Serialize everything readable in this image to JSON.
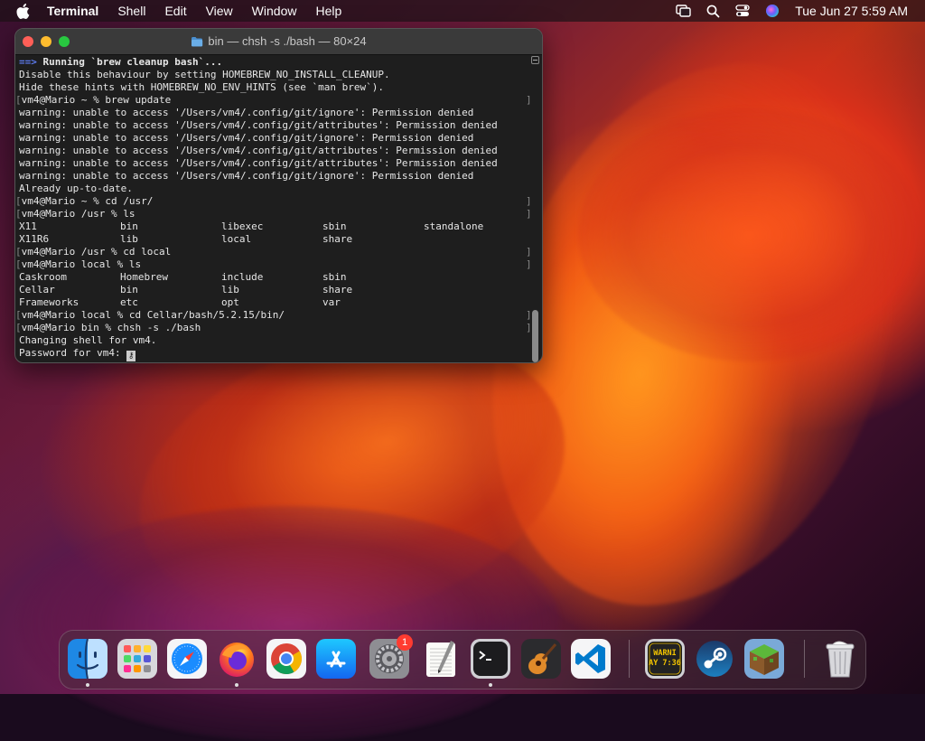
{
  "menubar": {
    "app_name": "Terminal",
    "items": [
      "Shell",
      "Edit",
      "View",
      "Window",
      "Help"
    ],
    "clock": "Tue Jun 27  5:59 AM",
    "status_icons": [
      "screen-mirroring-icon",
      "search-icon",
      "control-center-icon",
      "siri-icon"
    ]
  },
  "terminal": {
    "title": "bin — chsh -s ./bash — 80×24",
    "lines": [
      {
        "type": "arrow",
        "prefix": "==>",
        "text": " Running `brew cleanup bash`..."
      },
      {
        "type": "text",
        "text": "Disable this behaviour by setting HOMEBREW_NO_INSTALL_CLEANUP."
      },
      {
        "type": "text",
        "text": "Hide these hints with HOMEBREW_NO_ENV_HINTS (see `man brew`)."
      },
      {
        "type": "prompt",
        "text": "vm4@Mario ~ % brew update"
      },
      {
        "type": "text",
        "text": "warning: unable to access '/Users/vm4/.config/git/ignore': Permission denied"
      },
      {
        "type": "text",
        "text": "warning: unable to access '/Users/vm4/.config/git/attributes': Permission denied"
      },
      {
        "type": "text",
        "text": "warning: unable to access '/Users/vm4/.config/git/ignore': Permission denied"
      },
      {
        "type": "text",
        "text": "warning: unable to access '/Users/vm4/.config/git/attributes': Permission denied"
      },
      {
        "type": "text",
        "text": "warning: unable to access '/Users/vm4/.config/git/attributes': Permission denied"
      },
      {
        "type": "text",
        "text": "warning: unable to access '/Users/vm4/.config/git/ignore': Permission denied"
      },
      {
        "type": "text",
        "text": "Already up-to-date."
      },
      {
        "type": "prompt",
        "text": "vm4@Mario ~ % cd /usr/"
      },
      {
        "type": "prompt",
        "text": "vm4@Mario /usr % ls"
      },
      {
        "type": "cols",
        "cells": [
          "X11",
          "bin",
          "libexec",
          "sbin",
          "standalone"
        ]
      },
      {
        "type": "cols",
        "cells": [
          "X11R6",
          "lib",
          "local",
          "share"
        ]
      },
      {
        "type": "prompt",
        "text": "vm4@Mario /usr % cd local"
      },
      {
        "type": "prompt",
        "text": "vm4@Mario local % ls"
      },
      {
        "type": "cols",
        "cells": [
          "Caskroom",
          "Homebrew",
          "include",
          "sbin"
        ]
      },
      {
        "type": "cols",
        "cells": [
          "Cellar",
          "bin",
          "lib",
          "share"
        ]
      },
      {
        "type": "cols",
        "cells": [
          "Frameworks",
          "etc",
          "opt",
          "var"
        ]
      },
      {
        "type": "prompt",
        "text": "vm4@Mario local % cd Cellar/bash/5.2.15/bin/"
      },
      {
        "type": "prompt",
        "text": "vm4@Mario bin % chsh -s ./bash"
      },
      {
        "type": "text",
        "text": "Changing shell for vm4."
      },
      {
        "type": "password",
        "text": "Password for vm4: "
      }
    ]
  },
  "dock": {
    "apps": [
      {
        "name": "Finder",
        "icon": "finder-icon",
        "running": true
      },
      {
        "name": "Launchpad",
        "icon": "launchpad-icon",
        "running": false
      },
      {
        "name": "Safari",
        "icon": "safari-icon",
        "running": false
      },
      {
        "name": "Firefox",
        "icon": "firefox-icon",
        "running": true
      },
      {
        "name": "Chrome",
        "icon": "chrome-icon",
        "running": false
      },
      {
        "name": "App Store",
        "icon": "app-store-icon",
        "running": false
      },
      {
        "name": "System Preferences",
        "icon": "system-preferences-icon",
        "running": false,
        "badge": "1"
      },
      {
        "name": "TextEdit",
        "icon": "textedit-icon",
        "running": false
      },
      {
        "name": "Terminal",
        "icon": "terminal-icon",
        "running": true
      },
      {
        "name": "GarageBand",
        "icon": "garageband-icon",
        "running": false
      },
      {
        "name": "VS Code",
        "icon": "vscode-icon",
        "running": false
      },
      {
        "name": "Console",
        "icon": "console-icon",
        "running": false,
        "label": "WARNI\nAY 7:36"
      },
      {
        "name": "Steam",
        "icon": "steam-icon",
        "running": false
      },
      {
        "name": "Minecraft",
        "icon": "minecraft-icon",
        "running": false
      },
      {
        "name": "Trash",
        "icon": "trash-icon",
        "running": false
      }
    ]
  },
  "colors": {
    "arrow": "#5d7cf0",
    "terminal_bg": "#1e1e1e",
    "badge": "#ff3b30"
  }
}
